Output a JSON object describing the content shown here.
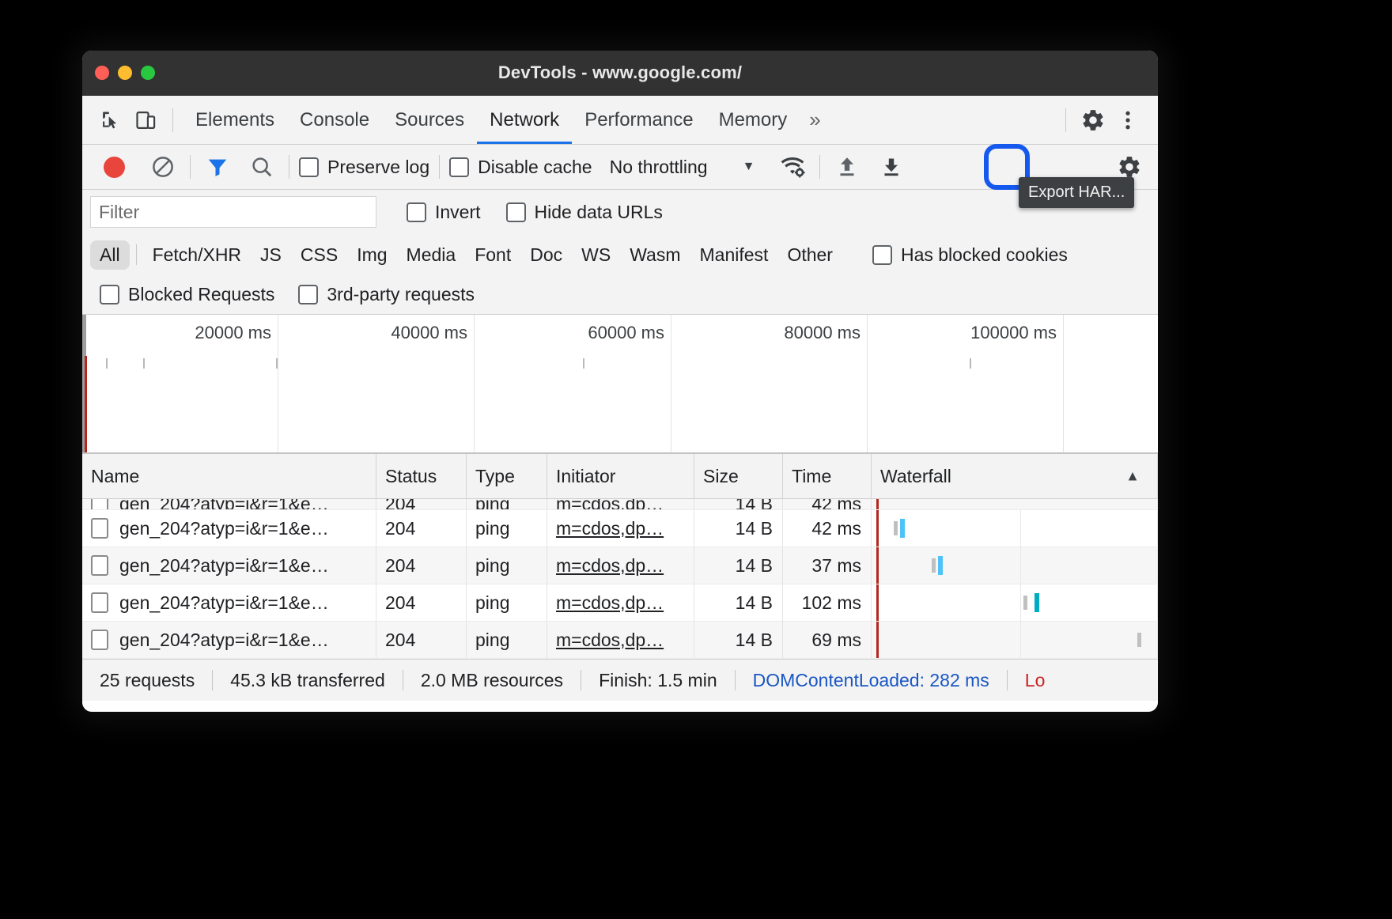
{
  "window": {
    "title": "DevTools - www.google.com/",
    "traffic_lights": [
      "close",
      "minimize",
      "zoom"
    ]
  },
  "tabbar": {
    "inspect_icon": "inspect-element-icon",
    "device_icon": "device-toolbar-icon",
    "tabs": [
      {
        "label": "Elements",
        "active": false
      },
      {
        "label": "Console",
        "active": false
      },
      {
        "label": "Sources",
        "active": false
      },
      {
        "label": "Network",
        "active": true
      },
      {
        "label": "Performance",
        "active": false
      },
      {
        "label": "Memory",
        "active": false
      }
    ],
    "more_tabs": "»",
    "settings_icon": "gear-icon",
    "more_icon": "kebab-menu-icon"
  },
  "network_toolbar": {
    "record_icon": "record-button",
    "clear_icon": "clear-icon",
    "filter_icon": "filter-icon",
    "search_icon": "search-icon",
    "preserve_log": {
      "label": "Preserve log",
      "checked": false
    },
    "disable_cache": {
      "label": "Disable cache",
      "checked": false
    },
    "throttling": {
      "value": "No throttling",
      "caret": "▼"
    },
    "network_conditions_icon": "wifi-settings-icon",
    "import_har_icon": "import-har-upload-icon",
    "export_har_icon": "export-har-download-icon",
    "settings_icon": "gear-icon",
    "export_tooltip": "Export HAR...",
    "highlight_color": "#1558ee"
  },
  "filter_bar": {
    "input_placeholder": "Filter",
    "input_value": "",
    "invert": {
      "label": "Invert",
      "checked": false
    },
    "hide_data_urls": {
      "label": "Hide data URLs",
      "checked": false
    }
  },
  "type_filters": {
    "chips": [
      "All",
      "Fetch/XHR",
      "JS",
      "CSS",
      "Img",
      "Media",
      "Font",
      "Doc",
      "WS",
      "Wasm",
      "Manifest",
      "Other"
    ],
    "selected": "All",
    "has_blocked_cookies": {
      "label": "Has blocked cookies",
      "checked": false
    },
    "blocked_requests": {
      "label": "Blocked Requests",
      "checked": false
    },
    "third_party_requests": {
      "label": "3rd-party requests",
      "checked": false
    }
  },
  "overview": {
    "tick_labels": [
      "20000 ms",
      "40000 ms",
      "60000 ms",
      "80000 ms",
      "100000 ms"
    ],
    "tick_values": [
      20000,
      40000,
      60000,
      80000,
      100000
    ]
  },
  "table": {
    "columns": [
      "Name",
      "Status",
      "Type",
      "Initiator",
      "Size",
      "Time",
      "Waterfall"
    ],
    "sort_column": "Waterfall",
    "sort_arrow": "▲",
    "rows": [
      {
        "name": "gen_204?atyp=i&r=1&e…",
        "status": "204",
        "type": "ping",
        "initiator": "m=cdos,dp…",
        "size": "14 B",
        "time": "42 ms"
      },
      {
        "name": "gen_204?atyp=i&r=1&e…",
        "status": "204",
        "type": "ping",
        "initiator": "m=cdos,dp…",
        "size": "14 B",
        "time": "37 ms"
      },
      {
        "name": "gen_204?atyp=i&r=1&e…",
        "status": "204",
        "type": "ping",
        "initiator": "m=cdos,dp…",
        "size": "14 B",
        "time": "102 ms"
      },
      {
        "name": "gen_204?atyp=i&r=1&e…",
        "status": "204",
        "type": "ping",
        "initiator": "m=cdos,dp…",
        "size": "14 B",
        "time": "69 ms"
      }
    ]
  },
  "status_bar": {
    "requests": "25 requests",
    "transferred": "45.3 kB transferred",
    "resources": "2.0 MB resources",
    "finish": "Finish: 1.5 min",
    "dom_content_loaded": "DOMContentLoaded: 282 ms",
    "load": "Lo",
    "dcl_color": "#1a56c4",
    "load_color": "#cc2222"
  }
}
